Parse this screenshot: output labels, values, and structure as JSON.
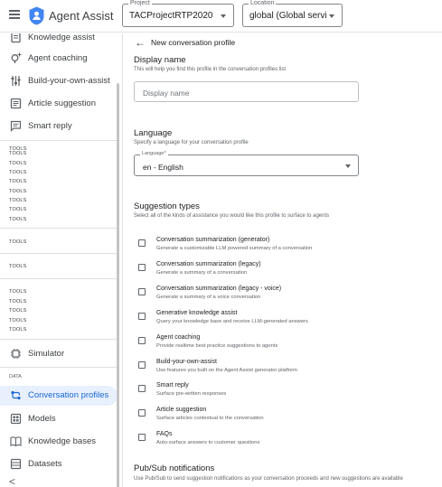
{
  "app": {
    "title": "Agent Assist"
  },
  "project": {
    "label": "Project",
    "value": "TACProjectRTP2020"
  },
  "location": {
    "label": "Location",
    "value": "global (Global servin..."
  },
  "sidebar": {
    "items_top": [
      {
        "label": "Knowledge assist",
        "icon": "knowledge-icon"
      },
      {
        "label": "Agent coaching",
        "icon": "coaching-icon"
      },
      {
        "label": "Build-your-own-assist",
        "icon": "tune-icon"
      },
      {
        "label": "Article suggestion",
        "icon": "article-icon"
      },
      {
        "label": "Smart reply",
        "icon": "reply-icon"
      }
    ],
    "tools_label": "TOOLS",
    "simulator": "Simulator",
    "data_section": "DATA",
    "items_data": [
      {
        "label": "Conversation profiles",
        "icon": "route-icon",
        "active": true
      },
      {
        "label": "Models",
        "icon": "models-icon"
      },
      {
        "label": "Knowledge bases",
        "icon": "book-icon"
      },
      {
        "label": "Datasets",
        "icon": "dataset-icon"
      }
    ],
    "collapse_glyph": "<"
  },
  "main": {
    "back_glyph": "←",
    "title": "New conversation profile",
    "display_name": {
      "heading": "Display name",
      "description": "This will help you find this profile in the conversation profiles list",
      "placeholder": "Display name"
    },
    "language": {
      "heading": "Language",
      "description": "Specify a language for your conversation profile",
      "field_label": "Language*",
      "value": "en - English"
    },
    "suggestion_types": {
      "heading": "Suggestion types",
      "description": "Select all of the kinds of assistance you would like this profile to surface to agents",
      "options": [
        {
          "title": "Conversation summarization (generator)",
          "desc": "Generate a customizable LLM powered summary of a conversation"
        },
        {
          "title": "Conversation summarization (legacy)",
          "desc": "Generate a summary of a conversation"
        },
        {
          "title": "Conversation summarization (legacy - voice)",
          "desc": "Generate a summary of a voice conversation"
        },
        {
          "title": "Generative knowledge assist",
          "desc": "Query your knowledge base and receive LLM-generated answers"
        },
        {
          "title": "Agent coaching",
          "desc": "Provide realtime best practice suggestions to agents"
        },
        {
          "title": "Build-your-own-assist",
          "desc": "Use features you built on the Agent Assist generator platform"
        },
        {
          "title": "Smart reply",
          "desc": "Surface pre-written responses"
        },
        {
          "title": "Article suggestion",
          "desc": "Surface articles contextual to the conversation"
        },
        {
          "title": "FAQs",
          "desc": "Auto-surface answers to customer questions"
        }
      ]
    },
    "pubsub": {
      "heading": "Pub/Sub notifications",
      "description": "Use Pub/Sub to send suggestion notifications as your conversation proceeds and new suggestions are available"
    }
  },
  "colors": {
    "accent": "#1967d2",
    "active_bg": "#e8f0fe",
    "logo_blue": "#4285f4"
  }
}
